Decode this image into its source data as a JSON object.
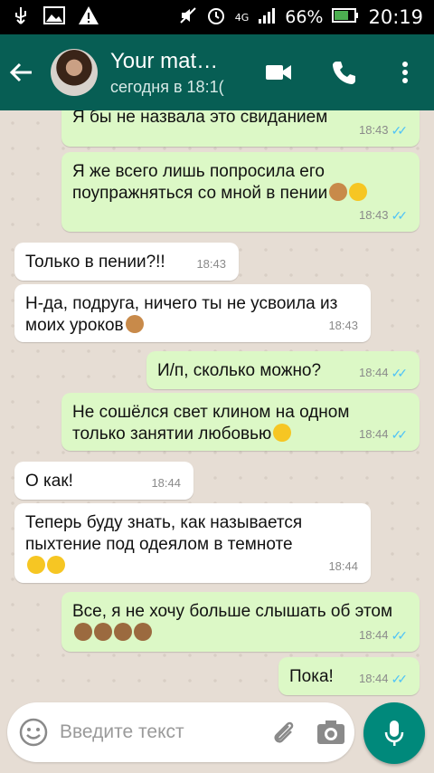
{
  "status_bar": {
    "network": "4G",
    "battery": "66%",
    "time": "20:19"
  },
  "header": {
    "contact_name": "Your mat…",
    "last_seen": "сегодня в 18:1("
  },
  "messages": [
    {
      "text": "Я бы не назвала это свиданием",
      "time": "18:43",
      "dir": "out"
    },
    {
      "text": "Я же всего лишь попросила его поупражняться со мной в пении",
      "time": "18:43",
      "dir": "out"
    },
    {
      "text": "Только в пении?!!",
      "time": "18:43",
      "dir": "in"
    },
    {
      "text": "Н-да, подруга, ничего ты не усвоила из моих уроков",
      "time": "18:43",
      "dir": "in"
    },
    {
      "text": "И/п, сколько можно?",
      "time": "18:44",
      "dir": "out"
    },
    {
      "text": "Не сошёлся свет клином на одном только занятии любовью",
      "time": "18:44",
      "dir": "out"
    },
    {
      "text": "О как!",
      "time": "18:44",
      "dir": "in"
    },
    {
      "text": "Теперь буду знать, как называется пыхтение под одеялом в темноте",
      "time": "18:44",
      "dir": "in"
    },
    {
      "text": "Все, я не хочу больше слышать об этом",
      "time": "18:44",
      "dir": "out"
    },
    {
      "text": "Пока!",
      "time": "18:44",
      "dir": "out"
    }
  ],
  "input": {
    "placeholder": "Введите текст"
  },
  "icons": {
    "back": "arrow-left-icon",
    "video": "video-camera-icon",
    "call": "phone-icon",
    "menu": "more-vert-icon",
    "emoji": "smiley-icon",
    "attach": "paperclip-icon",
    "camera": "camera-icon",
    "mic": "microphone-icon"
  },
  "colors": {
    "header": "#075e54",
    "outgoing_bubble": "#dcf8c6",
    "incoming_bubble": "#ffffff",
    "read_ticks": "#4fc3f7",
    "mic_button": "#00897b"
  }
}
